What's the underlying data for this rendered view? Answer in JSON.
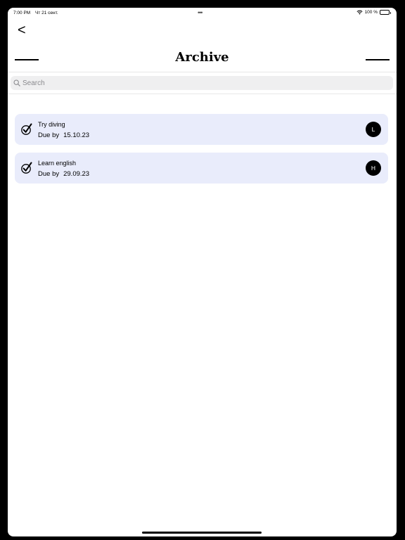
{
  "status_bar": {
    "time": "7:00 PM",
    "date": "Чт 21 сент.",
    "battery": "100 %"
  },
  "nav": {
    "back_label": "<",
    "title": "Archive"
  },
  "search": {
    "placeholder": "Search"
  },
  "tasks": [
    {
      "title": "Try diving",
      "due_label": "Due by",
      "due_date": "15.10.23",
      "avatar": "L"
    },
    {
      "title": "Learn english",
      "due_label": "Due by",
      "due_date": "29.09.23",
      "avatar": "H"
    }
  ],
  "colors": {
    "card_bg": "#e9ecfb",
    "search_bg": "#efeff0",
    "avatar_bg": "#000000"
  }
}
